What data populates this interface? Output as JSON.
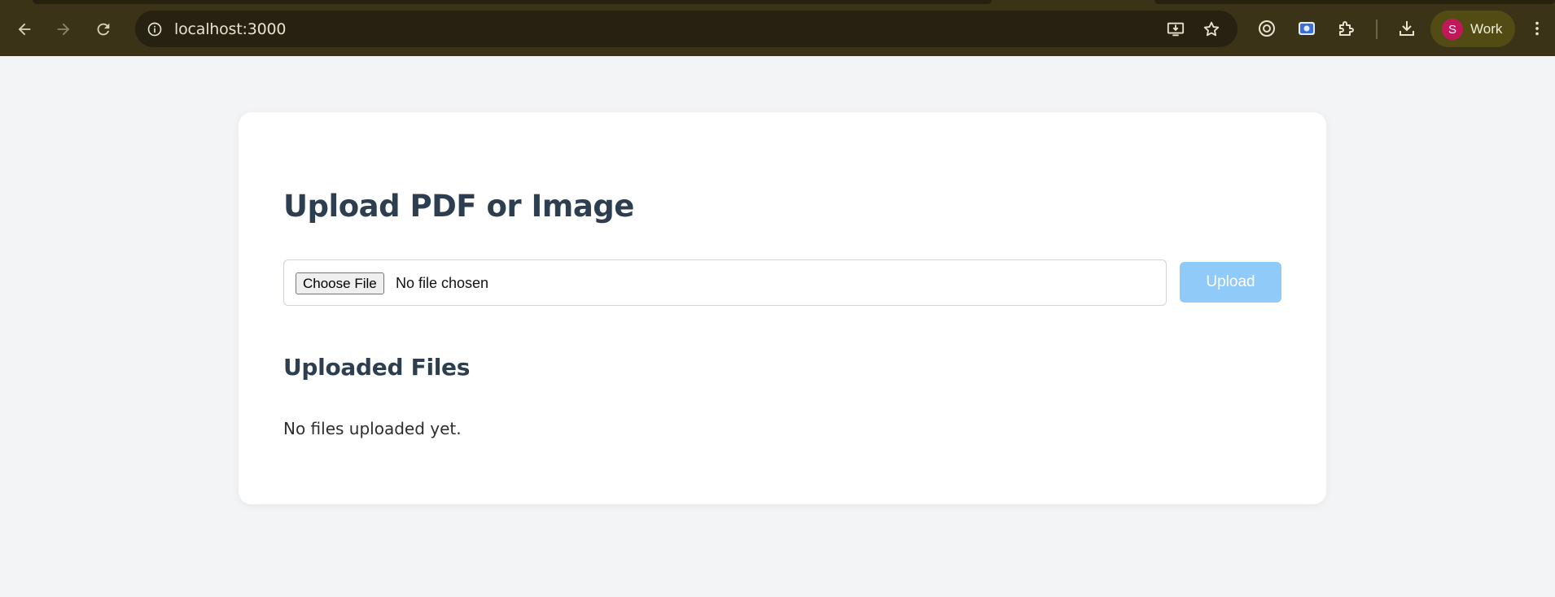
{
  "browser": {
    "url": "localhost:3000",
    "profile_initial": "S",
    "profile_name": "Work",
    "colors": {
      "toolbar": "#3a3317",
      "omnibox": "#262110",
      "profile_pill": "#524b14",
      "avatar": "#c2185b"
    },
    "icons": [
      "back-arrow-icon",
      "forward-arrow-icon",
      "reload-icon",
      "site-info-icon",
      "install-app-icon",
      "bookmark-star-icon",
      "lens-icon",
      "screenshot-icon",
      "extensions-puzzle-icon",
      "downloads-icon",
      "kebab-menu-icon"
    ]
  },
  "page": {
    "title": "Upload PDF or Image",
    "file_input": {
      "button_label": "Choose File",
      "status": "No file chosen"
    },
    "upload_button": "Upload",
    "uploaded_heading": "Uploaded Files",
    "empty_message": "No files uploaded yet.",
    "colors": {
      "background": "#f3f4f6",
      "card": "#ffffff",
      "heading": "#2c3e50",
      "upload_button": "#90caf9"
    }
  }
}
